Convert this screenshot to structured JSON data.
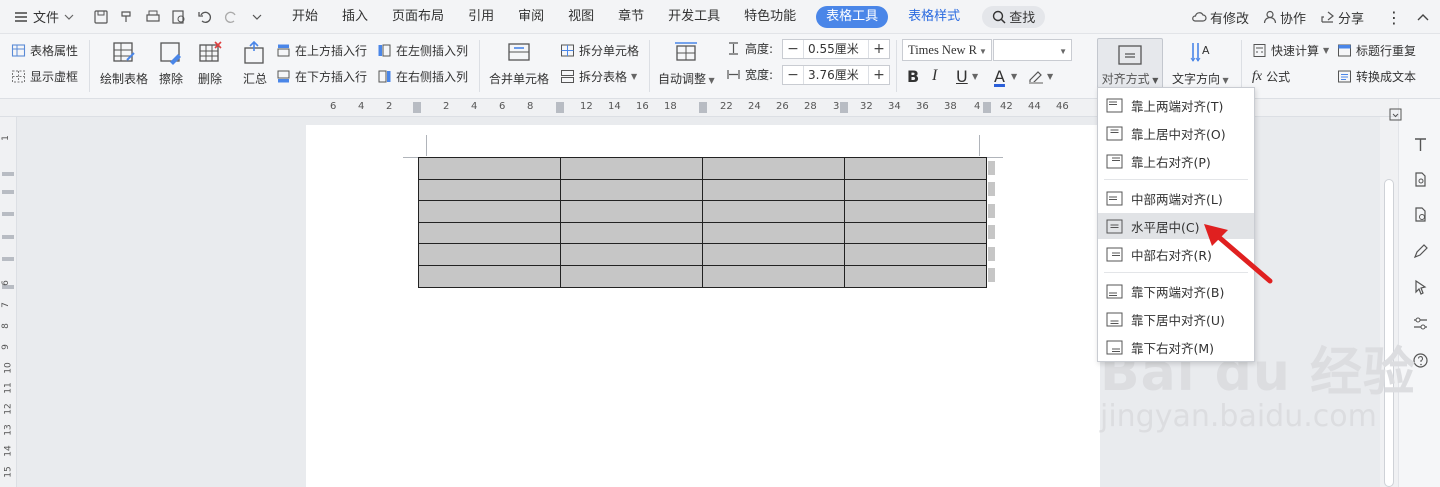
{
  "titlebar": {
    "menu_label": "文件",
    "tabs": [
      {
        "label": "开始"
      },
      {
        "label": "插入"
      },
      {
        "label": "页面布局"
      },
      {
        "label": "引用"
      },
      {
        "label": "审阅"
      },
      {
        "label": "视图"
      },
      {
        "label": "章节"
      },
      {
        "label": "开发工具"
      },
      {
        "label": "特色功能"
      },
      {
        "label": "表格工具"
      },
      {
        "label": "表格样式"
      }
    ],
    "search_label": "查找",
    "modified_label": "有修改",
    "collab_label": "协作",
    "share_label": "分享"
  },
  "ribbon": {
    "table_props": "表格属性",
    "show_gridlines": "显示虚框",
    "draw_table": "绘制表格",
    "erase": "擦除",
    "delete": "删除",
    "summary": "汇总",
    "insert_above": "在上方插入行",
    "insert_below": "在下方插入行",
    "insert_left": "在左侧插入列",
    "insert_right": "在右侧插入列",
    "merge_cells": "合并单元格",
    "split_cells": "拆分单元格",
    "split_table": "拆分表格",
    "auto_fit": "自动调整",
    "height_label": "高度:",
    "height_value": "0.55厘米",
    "width_label": "宽度:",
    "width_value": "3.76厘米",
    "font_name": "Times New R",
    "bold": "B",
    "italic": "I",
    "underline": "U",
    "font_color": "A",
    "alignment": "对齐方式",
    "text_direction": "文字方向",
    "quick_calc": "快速计算",
    "repeat_header": "标题行重复",
    "formula": "公式",
    "convert_to_text": "转换成文本"
  },
  "ruler": {
    "ticks": [
      "6",
      "4",
      "2",
      "2",
      "4",
      "6",
      "8",
      "12",
      "14",
      "16",
      "18",
      "22",
      "24",
      "26",
      "28",
      "3",
      "32",
      "34",
      "36",
      "38",
      "4",
      "42",
      "44",
      "46"
    ],
    "vticks": [
      "1",
      "6",
      "7",
      "8",
      "9",
      "10",
      "11",
      "12",
      "13",
      "14",
      "15"
    ]
  },
  "alignment_menu": {
    "items": [
      {
        "label": "靠上两端对齐(T)"
      },
      {
        "label": "靠上居中对齐(O)"
      },
      {
        "label": "靠上右对齐(P)"
      },
      {
        "label": "中部两端对齐(L)"
      },
      {
        "label": "水平居中(C)"
      },
      {
        "label": "中部右对齐(R)"
      },
      {
        "label": "靠下两端对齐(B)"
      },
      {
        "label": "靠下居中对齐(U)"
      },
      {
        "label": "靠下右对齐(M)"
      }
    ]
  },
  "watermark": {
    "logo": "Bai du 经验",
    "url": "jingyan.baidu.com"
  },
  "colors": {
    "accent": "#4a86e8",
    "highlight_tab_text": "#2b6be0",
    "arrow": "#e02020",
    "table_fill": "#c6c6c6"
  }
}
